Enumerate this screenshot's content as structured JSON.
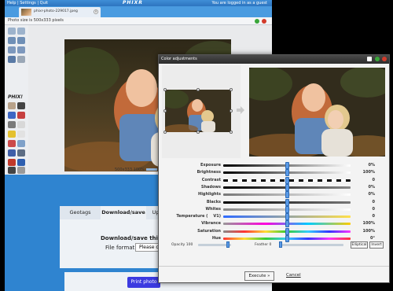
{
  "app": {
    "menu": "Help | Settings | Quit",
    "brand": "PHIXR",
    "status": "You are logged in as a guest",
    "file_name": "phixr-photo-229017.jpeg",
    "size_text": "Photo size is 500x333 pixels",
    "zoom_text": "500x333 100%",
    "phix_label": "PHIX!"
  },
  "bottom": {
    "tabs": [
      "Geotags",
      "Download/save",
      "Uplo"
    ],
    "download_title": "Download/save this photo",
    "format_label": "File format:",
    "format_value": "Please choo",
    "print_label": "Print photo"
  },
  "dialog": {
    "title": "Color adjustments",
    "sliders": [
      {
        "label": "Exposure",
        "value": "0%",
        "level": 0.5
      },
      {
        "label": "Brightness",
        "value": "100%",
        "level": 0.5
      },
      {
        "label": "Contrast",
        "value": "0",
        "level": 0.5
      },
      {
        "label": "Shadows",
        "value": "0%",
        "level": 0.5
      },
      {
        "label": "Highlights",
        "value": "0%",
        "level": 0.5
      },
      {
        "label": "Blacks",
        "value": "0",
        "level": 0.5
      },
      {
        "label": "Whites",
        "value": "0",
        "level": 0.5
      },
      {
        "label": "Temperature (    V1)",
        "value": "0",
        "level": 0.5
      },
      {
        "label": "Vibrance",
        "value": "100%",
        "level": 0.5
      },
      {
        "label": "Saturation",
        "value": "100%",
        "level": 0.5
      },
      {
        "label": "Hue",
        "value": "0°",
        "level": 0.5
      }
    ],
    "opacity_label": "Opacity 100",
    "feather_label": "Feather 0",
    "elliptical_label": "Elliptical",
    "invert_label": "Invert",
    "execute_label": "Execute »",
    "cancel_label": "Cancel"
  }
}
